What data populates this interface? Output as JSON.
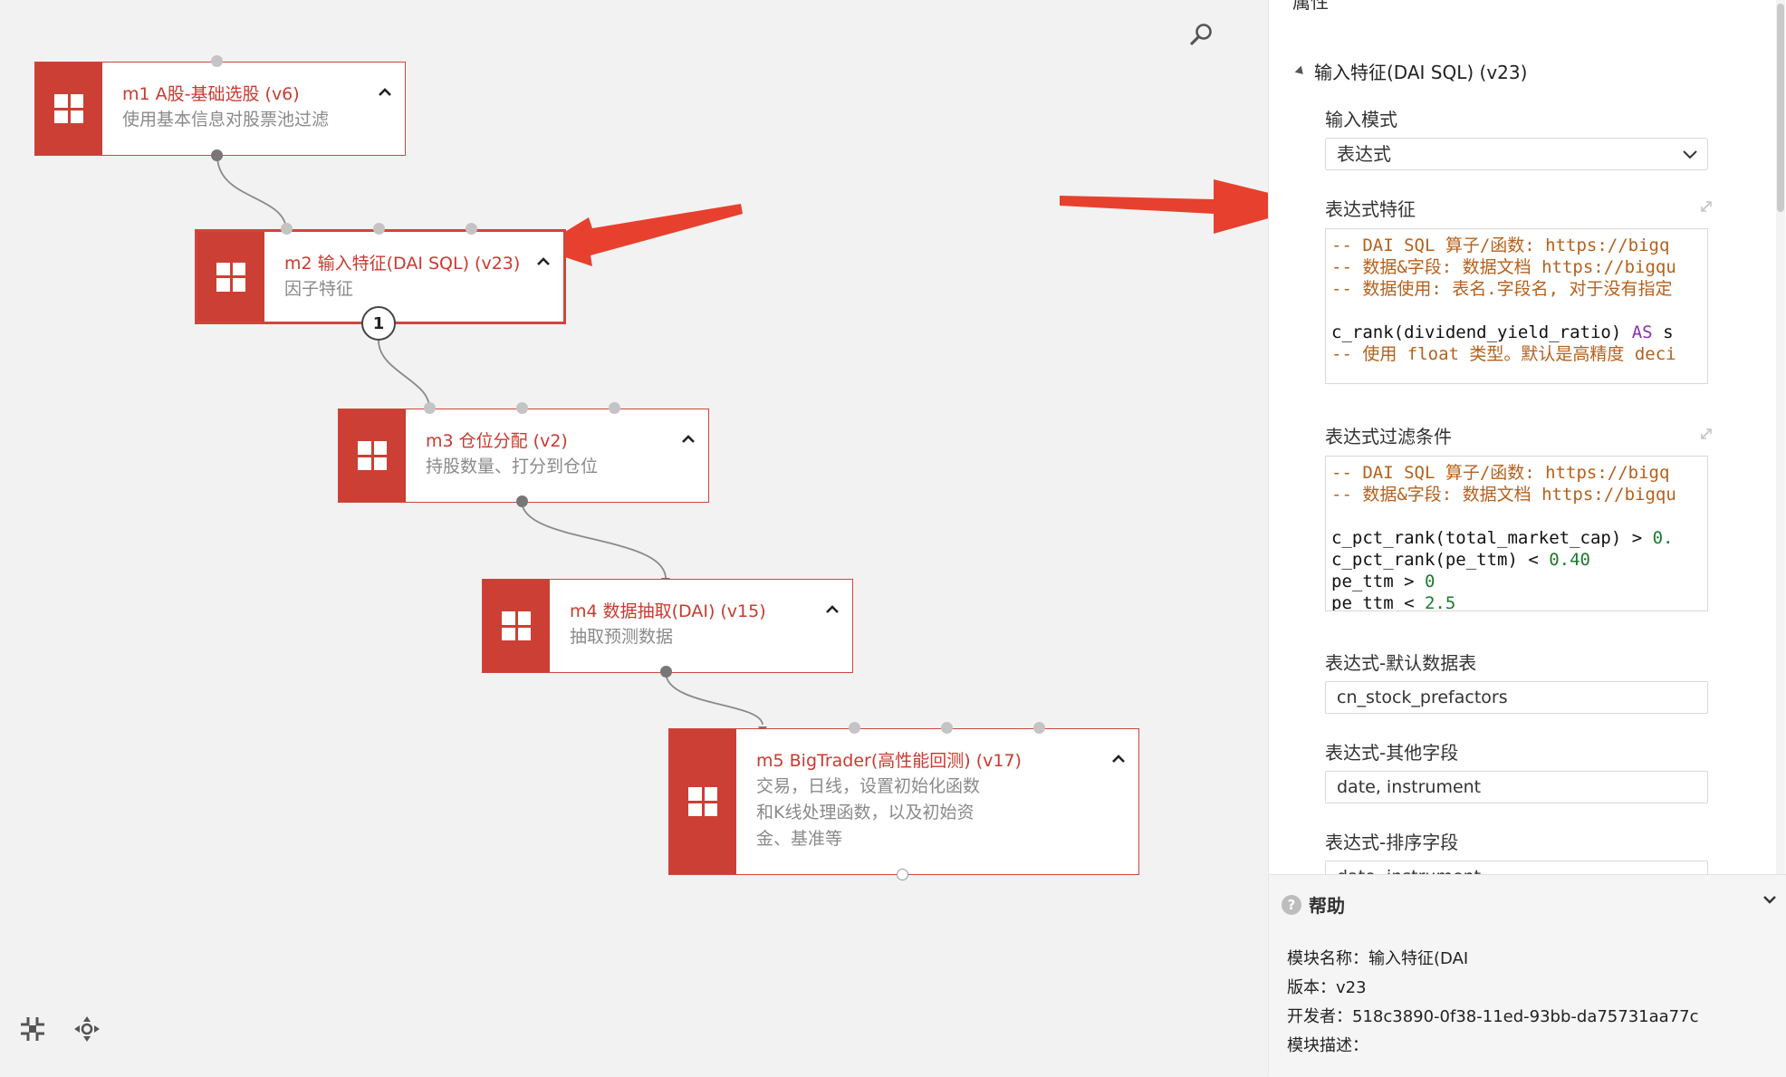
{
  "canvas": {
    "nodes": [
      {
        "id": "m1",
        "title": "m1 A股-基础选股 (v6)",
        "desc_lines": [
          "使用基本信息对股票池过滤"
        ]
      },
      {
        "id": "m2",
        "title": "m2 输入特征(DAI SQL) (v23)",
        "desc_lines": [
          "因子特征"
        ],
        "badge": "1"
      },
      {
        "id": "m3",
        "title": "m3 仓位分配 (v2)",
        "desc_lines": [
          "持股数量、打分到仓位"
        ]
      },
      {
        "id": "m4",
        "title": "m4 数据抽取(DAI) (v15)",
        "desc_lines": [
          "抽取预测数据"
        ]
      },
      {
        "id": "m5",
        "title": "m5 BigTrader(高性能回测) (v17)",
        "desc_lines": [
          "交易，日线，设置初始化函数",
          "和K线处理函数，以及初始资",
          "金、基准等"
        ]
      }
    ],
    "colors": {
      "node_accent": "#cc3f34",
      "node_title": "#c93a2f",
      "annotation_arrow": "#e8402e"
    },
    "icons": {
      "search": "magnifier-icon",
      "fit": "fit-to-screen-icon",
      "pan": "move-icon"
    }
  },
  "panel": {
    "top_title": "属性",
    "section_title": "输入特征(DAI SQL) (v23)",
    "input_mode": {
      "label": "输入模式",
      "value": "表达式"
    },
    "expr_features": {
      "label": "表达式特征",
      "lines": [
        {
          "segments": [
            {
              "t": "-- DAI SQL 算子/函数: https://bigq",
              "c": "comment"
            }
          ]
        },
        {
          "segments": [
            {
              "t": "-- 数据&字段: 数据文档 https://bigqu",
              "c": "comment"
            }
          ]
        },
        {
          "segments": [
            {
              "t": "-- 数据使用: 表名.字段名, 对于没有指定",
              "c": "comment"
            }
          ]
        },
        {
          "segments": []
        },
        {
          "segments": [
            {
              "t": "c_rank(dividend_yield_ratio) ",
              "c": "plain"
            },
            {
              "t": "AS",
              "c": "keyword"
            },
            {
              "t": " s",
              "c": "plain"
            }
          ]
        },
        {
          "segments": [
            {
              "t": "-- 使用 float 类型。默认是高精度 deci",
              "c": "comment"
            }
          ]
        }
      ]
    },
    "expr_filter": {
      "label": "表达式过滤条件",
      "lines": [
        {
          "segments": [
            {
              "t": "-- DAI SQL 算子/函数: https://bigq",
              "c": "comment"
            }
          ]
        },
        {
          "segments": [
            {
              "t": "-- 数据&字段: 数据文档 https://bigqu",
              "c": "comment"
            }
          ]
        },
        {
          "segments": []
        },
        {
          "segments": [
            {
              "t": "c_pct_rank(total_market_cap) > ",
              "c": "plain"
            },
            {
              "t": "0.",
              "c": "number"
            }
          ]
        },
        {
          "segments": [
            {
              "t": "c_pct_rank(pe_ttm) < ",
              "c": "plain"
            },
            {
              "t": "0.40",
              "c": "number"
            }
          ]
        },
        {
          "segments": [
            {
              "t": "pe_ttm > ",
              "c": "plain"
            },
            {
              "t": "0",
              "c": "number"
            }
          ]
        },
        {
          "segments": [
            {
              "t": "pe_ttm < ",
              "c": "plain"
            },
            {
              "t": "2.5",
              "c": "number"
            }
          ]
        }
      ]
    },
    "default_table": {
      "label": "表达式-默认数据表",
      "value": "cn_stock_prefactors"
    },
    "other_fields": {
      "label": "表达式-其他字段",
      "value": "date, instrument"
    },
    "sort_fields": {
      "label": "表达式-排序字段",
      "value": "date, instrument"
    }
  },
  "help": {
    "title": "帮助",
    "module_name": "模块名称：输入特征(DAI",
    "version": "版本：v23",
    "developer": "开发者：518c3890-0f38-11ed-93bb-da75731aa77c",
    "description": "模块描述："
  }
}
